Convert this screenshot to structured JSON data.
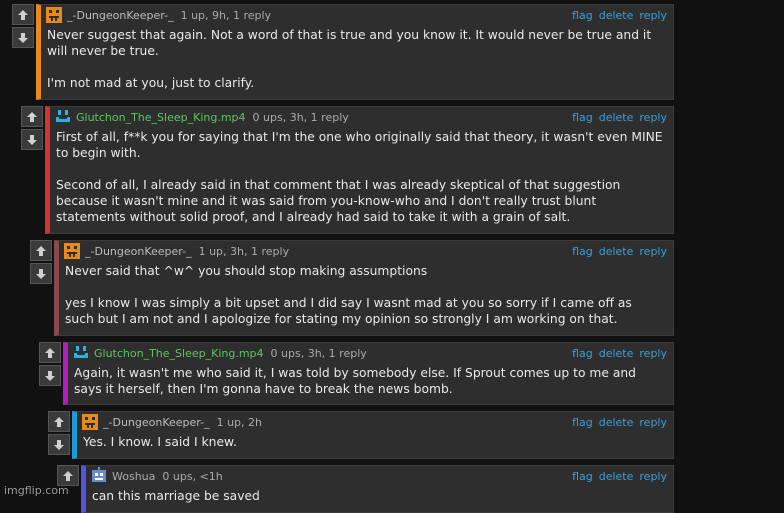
{
  "comments": [
    {
      "username": "_-DungeonKeeper-_",
      "meta": "1 up, 9h, 1 reply",
      "paragraphs": [
        "Never suggest that again. Not a word of that is true and you know it. It would never be true and it will never be true.",
        "I'm not mad at you, just to clarify."
      ],
      "accent": "#e8891c",
      "avatar": "orange-pixel-face-icon"
    },
    {
      "username": "Glutchon_The_Sleep_King.mp4",
      "meta": "0 ups, 3h, 1 reply",
      "paragraphs": [
        "First of all, f**k you for saying that I'm the one who originally said that theory, it wasn't even MINE to begin with.",
        "Second of all, I already said in that comment that I was already skeptical of that suggestion because it wasn't mine and it was said from you-know-who and I don't really trust blunt statements without solid proof, and I already had said to take it with a grain of salt."
      ],
      "accent": "#d23232",
      "avatar": "blue-smile-face-icon"
    },
    {
      "username": "_-DungeonKeeper-_",
      "meta": "1 up, 3h, 1 reply",
      "paragraphs": [
        "Never said that ^w^ you should stop making assumptions",
        "yes I know I was simply a bit upset and I did say I wasnt mad at you so sorry if I came off as such but I am not and I apologize for stating my opinion so strongly I am working on that."
      ],
      "accent": "#8a4a4a",
      "avatar": "orange-pixel-face-icon"
    },
    {
      "username": "Glutchon_The_Sleep_King.mp4",
      "meta": "0 ups, 3h, 1 reply",
      "paragraphs": [
        "Again, it wasn't me who said it, I was told by somebody else. If Sprout comes up to me and says it herself, then I'm gonna have to break the news bomb."
      ],
      "accent": "#b020b8",
      "avatar": "blue-smile-face-icon"
    },
    {
      "username": "_-DungeonKeeper-_",
      "meta": "1 up, 2h",
      "paragraphs": [
        "Yes. I know. I said I knew."
      ],
      "accent": "#1c9bd6",
      "avatar": "orange-pixel-face-icon"
    },
    {
      "username": "Woshua",
      "meta": "0 ups, <1h",
      "paragraphs": [
        "can this marriage be saved"
      ],
      "accent": "#5555dd",
      "avatar": "robot-face-icon"
    }
  ],
  "actions": {
    "flag": "flag",
    "delete": "delete",
    "reply": "reply"
  },
  "watermark": "imgflip.com"
}
